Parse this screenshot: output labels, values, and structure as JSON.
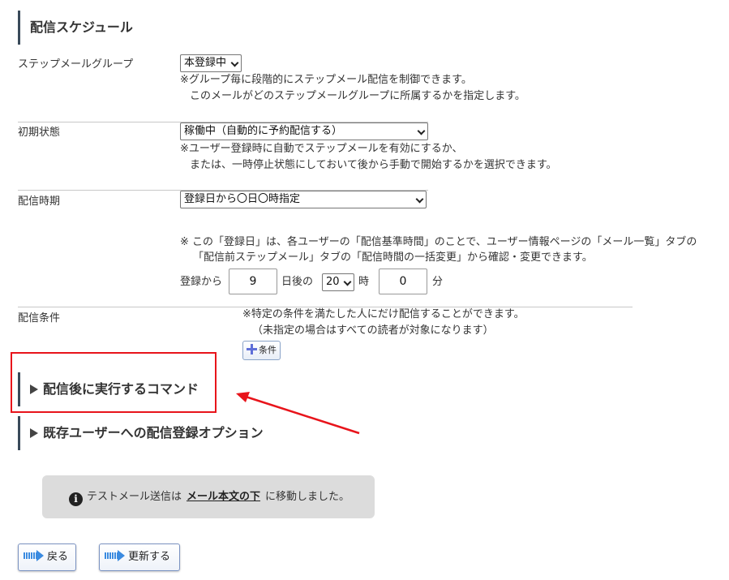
{
  "schedule": {
    "title": "配信スケジュール"
  },
  "step_group": {
    "label": "ステップメールグループ",
    "selected": "本登録中",
    "note_1": "※グループ毎に段階的にステップメール配信を制御できます。",
    "note_2": "このメールがどのステップメールグループに所属するかを指定します。"
  },
  "initial_state": {
    "label": "初期状態",
    "selected": "稼働中（自動的に予約配信する）",
    "note_1": "※ユーザー登録時に自動でステップメールを有効にするか、",
    "note_2": "または、一時停止状態にしておいて後から手動で開始するかを選択できます。"
  },
  "timing": {
    "label": "配信時期",
    "selected": "登録日から〇日〇時指定",
    "note_1": "※ この「登録日」は、各ユーザーの「配信基準時間」のことで、ユーザー情報ページの「メール一覧」タブの",
    "note_2": "「配信前ステップメール」タブの「配信時間の一括変更」から確認・変更できます。",
    "from_label": "登録から",
    "days_value": "9",
    "days_after_label": "日後の",
    "hour_selected": "20",
    "hour_label": "時",
    "minute_value": "0",
    "minute_label": "分"
  },
  "condition": {
    "label": "配信条件",
    "note_1": "※特定の条件を満たした人にだけ配信することができます。",
    "note_2": "（未指定の場合はすべての読者が対象になります）",
    "button_label": "条件"
  },
  "sections": {
    "post_command": "配信後に実行するコマンド",
    "existing_users": "既存ユーザーへの配信登録オプション"
  },
  "info": {
    "text_before": "テストメール送信は",
    "link_text": "メール本文の下",
    "text_after": "に移動しました。"
  },
  "buttons": {
    "back": "戻る",
    "update": "更新する"
  },
  "colors": {
    "highlight": "#e8141b",
    "section_bar": "#3a4a5a",
    "info_bg": "#dcdcdc",
    "button_arrow": "#3b8be0"
  }
}
